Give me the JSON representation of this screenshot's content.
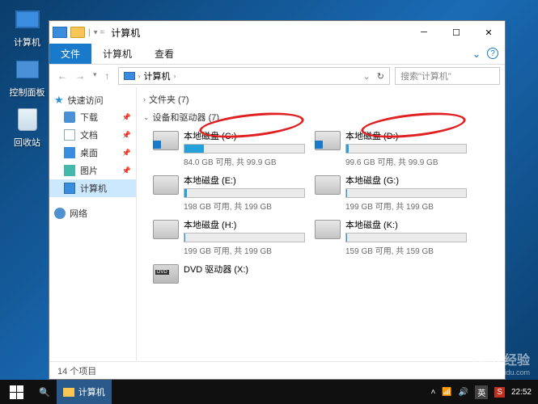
{
  "desktop": {
    "icons": [
      {
        "label": "计算机"
      },
      {
        "label": "控制面板"
      },
      {
        "label": "回收站"
      }
    ]
  },
  "window": {
    "title": "计算机",
    "tabs": {
      "file": "文件",
      "computer": "计算机",
      "view": "查看"
    },
    "address": {
      "root": "计算机"
    },
    "search_placeholder": "搜索\"计算机\"",
    "status": "14 个项目"
  },
  "nav": {
    "quick": "快速访问",
    "items": [
      {
        "label": "下载"
      },
      {
        "label": "文档"
      },
      {
        "label": "桌面"
      },
      {
        "label": "图片"
      },
      {
        "label": "计算机"
      }
    ],
    "network": "网络"
  },
  "content": {
    "folders_hdr": "文件夹 (7)",
    "drives_hdr": "设备和驱动器 (7)",
    "drives": [
      {
        "name": "本地磁盘 (C:)",
        "info": "84.0 GB 可用, 共 99.9 GB",
        "fill": 16,
        "sys": true
      },
      {
        "name": "本地磁盘 (D:)",
        "info": "99.6 GB 可用, 共 99.9 GB",
        "fill": 2,
        "sys": true
      },
      {
        "name": "本地磁盘 (E:)",
        "info": "198 GB 可用, 共 199 GB",
        "fill": 2
      },
      {
        "name": "本地磁盘 (G:)",
        "info": "199 GB 可用, 共 199 GB",
        "fill": 1
      },
      {
        "name": "本地磁盘 (H:)",
        "info": "199 GB 可用, 共 199 GB",
        "fill": 1
      },
      {
        "name": "本地磁盘 (K:)",
        "info": "159 GB 可用, 共 159 GB",
        "fill": 1
      }
    ],
    "dvd": {
      "name": "DVD 驱动器 (X:)"
    }
  },
  "taskbar": {
    "app": "计算机",
    "ime1": "英",
    "ime2": "S",
    "time": "22:52"
  },
  "watermark": {
    "brand": "Baid 经验",
    "url": "jingyan.baidu.com"
  }
}
